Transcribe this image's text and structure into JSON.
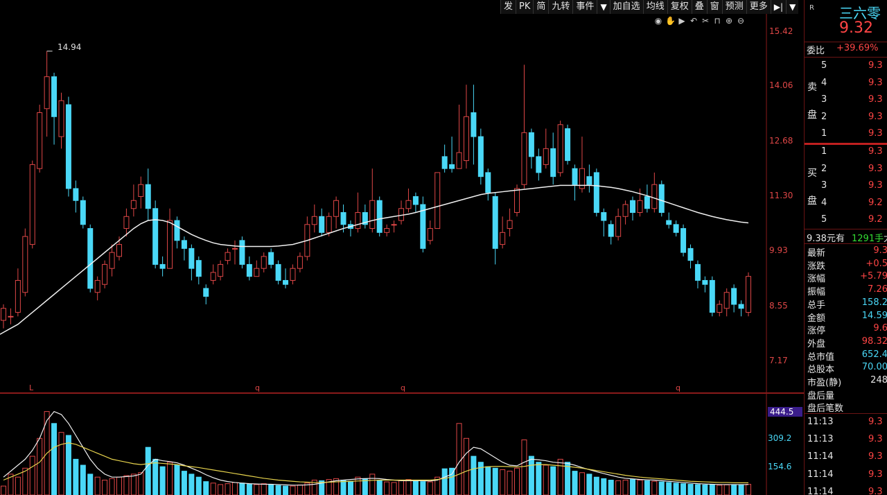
{
  "toolbar": {
    "items": [
      "发",
      "PK",
      "简",
      "九转",
      "事件",
      "▼",
      "加自选",
      "均线",
      "复权",
      "叠",
      "窗",
      "预测",
      "更多",
      "▶|",
      "▼"
    ]
  },
  "price_axis": [
    "15.42",
    "14.06",
    "12.68",
    "11.30",
    "9.93",
    "8.55",
    "7.17"
  ],
  "volume_axis": [
    "444.5",
    "309.2",
    "154.6"
  ],
  "date_markers": [
    "L",
    "q",
    "q",
    "q"
  ],
  "peak_label": "14.94",
  "colors": {
    "up": "#e04747",
    "down": "#4ad8f7",
    "ma": "#f0f0f0",
    "vol_ma2": "#e8d44d"
  },
  "panel": {
    "badge": "R",
    "stock_name": "三六零",
    "price": "9.32",
    "weibi_label": "委比",
    "weibi_value": "+39.69%",
    "sell_label": [
      "卖",
      "盘"
    ],
    "buy_label": [
      "买",
      "盘"
    ],
    "sell_levels": [
      {
        "n": "5",
        "p": "9.3"
      },
      {
        "n": "4",
        "p": "9.3"
      },
      {
        "n": "3",
        "p": "9.3"
      },
      {
        "n": "2",
        "p": "9.3"
      },
      {
        "n": "1",
        "p": "9.3"
      }
    ],
    "buy_levels": [
      {
        "n": "1",
        "p": "9.3"
      },
      {
        "n": "2",
        "p": "9.3"
      },
      {
        "n": "3",
        "p": "9.3"
      },
      {
        "n": "4",
        "p": "9.2"
      },
      {
        "n": "5",
        "p": "9.2"
      }
    ],
    "tick_info": {
      "price": "9.38元有",
      "vol": "1291手",
      "tail": "大"
    },
    "stats": [
      {
        "label": "最新",
        "value": "9.3",
        "color": "red"
      },
      {
        "label": "涨跌",
        "value": "+0.5",
        "color": "red"
      },
      {
        "label": "涨幅",
        "value": "+5.79",
        "color": "red"
      },
      {
        "label": "振幅",
        "value": "7.26",
        "color": "red"
      },
      {
        "label": "总手",
        "value": "158.2",
        "color": "cyan"
      },
      {
        "label": "金额",
        "value": "14.59",
        "color": "cyan"
      },
      {
        "label": "涨停",
        "value": "9.6",
        "color": "red"
      },
      {
        "label": "外盘",
        "value": "98.32",
        "color": "red"
      },
      {
        "label": "总市值",
        "value": "652.4",
        "color": "cyan"
      },
      {
        "label": "总股本",
        "value": "70.00",
        "color": "cyan"
      },
      {
        "label": "市盈(静)",
        "value": "248",
        "color": "white"
      },
      {
        "label": "盘后量",
        "value": "",
        "color": "white"
      },
      {
        "label": "盘后笔数",
        "value": "",
        "color": "white"
      }
    ],
    "trades": [
      {
        "t": "11:13",
        "p": "9.3"
      },
      {
        "t": "11:13",
        "p": "9.3"
      },
      {
        "t": "11:14",
        "p": "9.3"
      },
      {
        "t": "11:14",
        "p": "9.3"
      },
      {
        "t": "11:14",
        "p": "9.3"
      }
    ]
  },
  "chart_data": {
    "type": "candlestick",
    "y_range": [
      6.5,
      15.7
    ],
    "ticks": [
      15.42,
      14.06,
      12.68,
      11.3,
      9.93,
      8.55,
      7.17
    ],
    "candles": [
      [
        8.2,
        8.5,
        8.0,
        8.6
      ],
      [
        8.3,
        8.3,
        8.1,
        8.5
      ],
      [
        8.4,
        9.2,
        8.3,
        9.5
      ],
      [
        8.9,
        10.3,
        8.8,
        10.5
      ],
      [
        10.1,
        12.1,
        10.0,
        12.2
      ],
      [
        12.0,
        13.4,
        11.9,
        13.6
      ],
      [
        13.5,
        14.3,
        12.8,
        14.94
      ],
      [
        14.3,
        13.3,
        12.6,
        14.4
      ],
      [
        12.8,
        13.7,
        12.5,
        13.9
      ],
      [
        13.6,
        11.5,
        11.3,
        13.8
      ],
      [
        11.5,
        11.2,
        10.9,
        11.7
      ],
      [
        11.2,
        10.6,
        10.5,
        11.3
      ],
      [
        10.5,
        9.0,
        8.9,
        10.6
      ],
      [
        8.9,
        9.2,
        8.7,
        9.3
      ],
      [
        9.1,
        9.6,
        9.0,
        9.7
      ],
      [
        9.5,
        9.9,
        9.3,
        10.1
      ],
      [
        9.8,
        10.1,
        9.7,
        10.3
      ],
      [
        10.5,
        10.8,
        10.3,
        11.0
      ],
      [
        11.0,
        11.2,
        10.8,
        11.6
      ],
      [
        11.3,
        11.6,
        11.0,
        11.8
      ],
      [
        11.6,
        11.0,
        10.7,
        12.0
      ],
      [
        11.0,
        9.6,
        9.5,
        11.2
      ],
      [
        9.6,
        9.5,
        9.3,
        9.8
      ],
      [
        9.5,
        10.7,
        9.5,
        11.0
      ],
      [
        10.7,
        10.2,
        10.0,
        10.8
      ],
      [
        10.2,
        10.0,
        9.7,
        10.3
      ],
      [
        10.0,
        9.5,
        9.2,
        10.1
      ],
      [
        9.7,
        9.3,
        9.1,
        9.8
      ],
      [
        9.0,
        8.8,
        8.6,
        9.1
      ],
      [
        9.2,
        9.4,
        9.1,
        9.6
      ],
      [
        9.3,
        9.6,
        9.2,
        9.7
      ],
      [
        9.7,
        9.9,
        9.6,
        10.0
      ],
      [
        10.0,
        10.0,
        9.6,
        10.2
      ],
      [
        10.2,
        9.6,
        9.5,
        10.3
      ],
      [
        9.6,
        9.3,
        9.2,
        9.8
      ],
      [
        9.3,
        9.5,
        9.3,
        9.7
      ],
      [
        9.5,
        9.8,
        9.4,
        9.9
      ],
      [
        9.9,
        9.6,
        9.5,
        10.0
      ],
      [
        9.6,
        9.2,
        9.1,
        9.7
      ],
      [
        9.2,
        9.1,
        9.0,
        9.5
      ],
      [
        9.2,
        9.5,
        9.1,
        9.6
      ],
      [
        9.5,
        9.8,
        9.4,
        9.9
      ],
      [
        9.8,
        10.6,
        9.7,
        10.8
      ],
      [
        10.6,
        10.8,
        10.4,
        11.1
      ],
      [
        10.8,
        10.4,
        10.3,
        11.0
      ],
      [
        10.4,
        10.8,
        10.3,
        10.9
      ],
      [
        10.8,
        11.2,
        10.5,
        11.3
      ],
      [
        10.9,
        10.6,
        10.4,
        11.1
      ],
      [
        10.6,
        10.5,
        10.3,
        10.7
      ],
      [
        10.5,
        10.9,
        10.4,
        11.4
      ],
      [
        10.9,
        10.6,
        10.5,
        11.1
      ],
      [
        10.5,
        11.2,
        10.4,
        12.0
      ],
      [
        11.2,
        10.4,
        10.3,
        11.3
      ],
      [
        10.4,
        10.5,
        10.3,
        10.6
      ],
      [
        10.6,
        10.6,
        10.4,
        10.7
      ],
      [
        10.7,
        11.0,
        10.6,
        11.2
      ],
      [
        11.0,
        11.2,
        10.9,
        11.5
      ],
      [
        11.3,
        11.1,
        10.9,
        11.4
      ],
      [
        11.1,
        10.0,
        9.9,
        11.3
      ],
      [
        10.2,
        10.5,
        10.1,
        10.7
      ],
      [
        10.5,
        11.9,
        10.5,
        11.9
      ],
      [
        12.3,
        12.0,
        11.9,
        12.6
      ],
      [
        12.1,
        12.0,
        11.9,
        12.8
      ],
      [
        12.0,
        12.4,
        12.0,
        13.6
      ],
      [
        12.2,
        13.3,
        12.0,
        14.1
      ],
      [
        13.4,
        12.8,
        12.1,
        14.1
      ],
      [
        12.8,
        11.8,
        11.6,
        13.0
      ],
      [
        11.9,
        11.4,
        11.2,
        12.0
      ],
      [
        11.3,
        10.0,
        9.6,
        11.4
      ],
      [
        10.1,
        10.4,
        10.0,
        10.8
      ],
      [
        10.5,
        10.7,
        10.3,
        11.0
      ],
      [
        10.9,
        11.5,
        10.8,
        11.6
      ],
      [
        11.6,
        12.9,
        11.5,
        14.6
      ],
      [
        12.9,
        12.3,
        12.0,
        13.0
      ],
      [
        12.3,
        11.9,
        11.7,
        12.5
      ],
      [
        12.1,
        12.5,
        12.0,
        13.0
      ],
      [
        12.5,
        11.8,
        11.6,
        12.9
      ],
      [
        11.9,
        13.1,
        11.8,
        13.2
      ],
      [
        13.0,
        12.2,
        12.1,
        13.1
      ],
      [
        12.0,
        11.6,
        11.2,
        12.1
      ],
      [
        11.5,
        12.0,
        11.4,
        12.8
      ],
      [
        11.8,
        11.6,
        11.4,
        12.1
      ],
      [
        11.9,
        10.9,
        10.8,
        12.0
      ],
      [
        10.9,
        10.7,
        10.3,
        11.0
      ],
      [
        10.6,
        10.3,
        10.1,
        10.7
      ],
      [
        10.3,
        10.8,
        10.2,
        11.0
      ],
      [
        10.8,
        11.1,
        10.6,
        11.2
      ],
      [
        11.2,
        10.9,
        10.7,
        11.3
      ],
      [
        10.9,
        11.2,
        10.8,
        11.5
      ],
      [
        11.3,
        11.0,
        10.9,
        11.6
      ],
      [
        11.0,
        11.6,
        10.9,
        11.9
      ],
      [
        11.6,
        10.9,
        10.8,
        11.7
      ],
      [
        10.7,
        10.6,
        10.5,
        10.9
      ],
      [
        10.6,
        10.4,
        10.3,
        10.7
      ],
      [
        10.5,
        9.9,
        9.8,
        10.6
      ],
      [
        10.0,
        9.7,
        9.5,
        10.1
      ],
      [
        9.6,
        9.2,
        9.0,
        9.7
      ],
      [
        9.2,
        9.1,
        8.9,
        9.3
      ],
      [
        9.2,
        8.4,
        8.3,
        9.3
      ],
      [
        8.4,
        8.6,
        8.3,
        8.7
      ],
      [
        8.5,
        8.9,
        8.3,
        9.0
      ],
      [
        9.0,
        8.6,
        8.4,
        9.1
      ],
      [
        8.6,
        8.5,
        8.3,
        8.7
      ],
      [
        8.4,
        9.3,
        8.3,
        9.4
      ]
    ],
    "ma": [
      7.9,
      8.0,
      8.1,
      8.25,
      8.4,
      8.55,
      8.7,
      8.85,
      9.0,
      9.15,
      9.3,
      9.45,
      9.6,
      9.75,
      9.9,
      10.05,
      10.2,
      10.35,
      10.5,
      10.62,
      10.7,
      10.72,
      10.7,
      10.65,
      10.55,
      10.45,
      10.35,
      10.27,
      10.2,
      10.14,
      10.1,
      10.08,
      10.06,
      10.05,
      10.05,
      10.05,
      10.05,
      10.05,
      10.06,
      10.08,
      10.1,
      10.15,
      10.2,
      10.26,
      10.32,
      10.38,
      10.44,
      10.5,
      10.55,
      10.6,
      10.65,
      10.7,
      10.74,
      10.77,
      10.8,
      10.83,
      10.86,
      10.9,
      10.95,
      11.0,
      11.05,
      11.1,
      11.15,
      11.2,
      11.25,
      11.3,
      11.35,
      11.38,
      11.4,
      11.42,
      11.44,
      11.46,
      11.48,
      11.5,
      11.52,
      11.54,
      11.56,
      11.58,
      11.58,
      11.58,
      11.58,
      11.58,
      11.57,
      11.55,
      11.53,
      11.5,
      11.46,
      11.42,
      11.37,
      11.32,
      11.26,
      11.2,
      11.14,
      11.08,
      11.02,
      10.96,
      10.9,
      10.85,
      10.8,
      10.76,
      10.72,
      10.69,
      10.66,
      10.64
    ],
    "volumes": [
      30,
      70,
      60,
      90,
      130,
      190,
      280,
      240,
      210,
      200,
      120,
      100,
      70,
      60,
      50,
      55,
      60,
      65,
      70,
      75,
      160,
      120,
      95,
      110,
      100,
      80,
      70,
      60,
      45,
      40,
      35,
      38,
      42,
      40,
      36,
      35,
      38,
      34,
      32,
      30,
      30,
      34,
      40,
      50,
      48,
      52,
      55,
      50,
      46,
      60,
      55,
      70,
      48,
      44,
      42,
      48,
      52,
      50,
      45,
      44,
      60,
      88,
      90,
      240,
      190,
      130,
      110,
      95,
      90,
      85,
      80,
      90,
      185,
      130,
      110,
      100,
      95,
      120,
      110,
      80,
      75,
      70,
      60,
      55,
      50,
      48,
      50,
      52,
      50,
      48,
      46,
      44,
      42,
      40,
      38,
      36,
      35,
      34,
      34,
      33,
      34,
      35,
      34,
      36
    ],
    "vol_ma1": [
      60,
      80,
      100,
      120,
      150,
      190,
      250,
      280,
      270,
      240,
      200,
      160,
      120,
      90,
      70,
      60,
      60,
      62,
      64,
      70,
      100,
      120,
      115,
      112,
      108,
      100,
      90,
      80,
      68,
      58,
      50,
      45,
      42,
      40,
      38,
      37,
      36,
      36,
      35,
      34,
      33,
      33,
      34,
      36,
      40,
      44,
      48,
      50,
      52,
      54,
      55,
      56,
      55,
      52,
      50,
      48,
      48,
      48,
      48,
      47,
      50,
      60,
      70,
      110,
      140,
      160,
      155,
      140,
      125,
      110,
      100,
      98,
      110,
      120,
      118,
      115,
      110,
      108,
      106,
      100,
      92,
      85,
      78,
      72,
      66,
      60,
      56,
      54,
      52,
      51,
      50,
      48,
      46,
      44,
      42,
      40,
      38,
      37,
      36,
      35,
      35,
      35,
      35,
      35
    ],
    "vol_ma2": [
      50,
      60,
      70,
      80,
      95,
      110,
      140,
      160,
      170,
      175,
      170,
      160,
      150,
      140,
      130,
      120,
      115,
      110,
      105,
      102,
      105,
      108,
      106,
      104,
      102,
      98,
      95,
      92,
      88,
      84,
      80,
      76,
      72,
      68,
      64,
      60,
      56,
      53,
      50,
      48,
      46,
      44,
      43,
      42,
      42,
      43,
      44,
      45,
      46,
      47,
      48,
      49,
      50,
      50,
      50,
      50,
      50,
      50,
      50,
      50,
      52,
      56,
      60,
      70,
      80,
      88,
      92,
      95,
      96,
      96,
      95,
      94,
      96,
      100,
      102,
      102,
      100,
      98,
      96,
      93,
      90,
      86,
      82,
      78,
      74,
      70,
      66,
      63,
      60,
      58,
      56,
      54,
      52,
      50,
      48,
      46,
      45,
      44,
      43,
      42,
      42,
      41,
      41,
      41
    ]
  }
}
